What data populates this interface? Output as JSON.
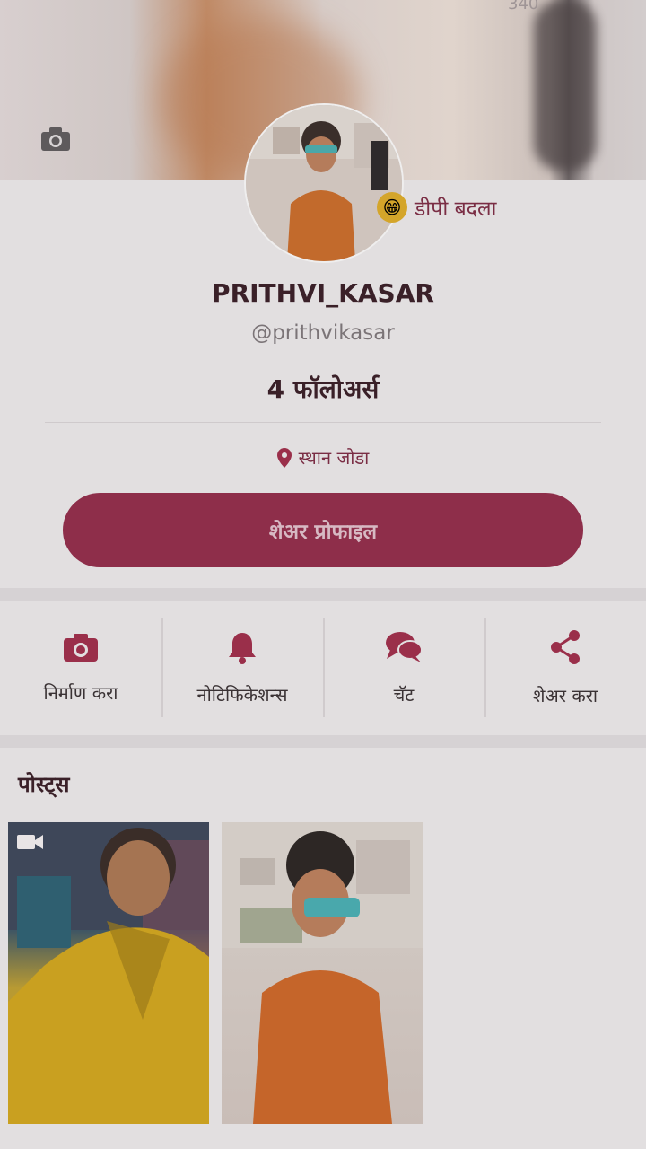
{
  "cover": {
    "counter": "340"
  },
  "profile": {
    "dp_change_label": "डीपी बदला",
    "dp_emoji": "😁",
    "name": "PRITHVI_KASAR",
    "handle": "@prithvikasar",
    "followers": "4 फॉलोअर्स",
    "location_label": "स्थान जोडा",
    "share_button": "शेअर प्रोफाइल"
  },
  "actions": [
    {
      "label": "निर्माण करा",
      "icon": "camera-icon"
    },
    {
      "label": "नोटिफिकेशन्स",
      "icon": "bell-icon"
    },
    {
      "label": "चॅट",
      "icon": "chat-icon"
    },
    {
      "label": "शेअर करा",
      "icon": "share-icon"
    }
  ],
  "posts": {
    "title": "पोस्ट्स",
    "items": [
      {
        "type": "video"
      },
      {
        "type": "image"
      }
    ]
  },
  "colors": {
    "accent": "#8e2e4a",
    "icon": "#9a2f4a",
    "background": "#e2dfe0"
  }
}
